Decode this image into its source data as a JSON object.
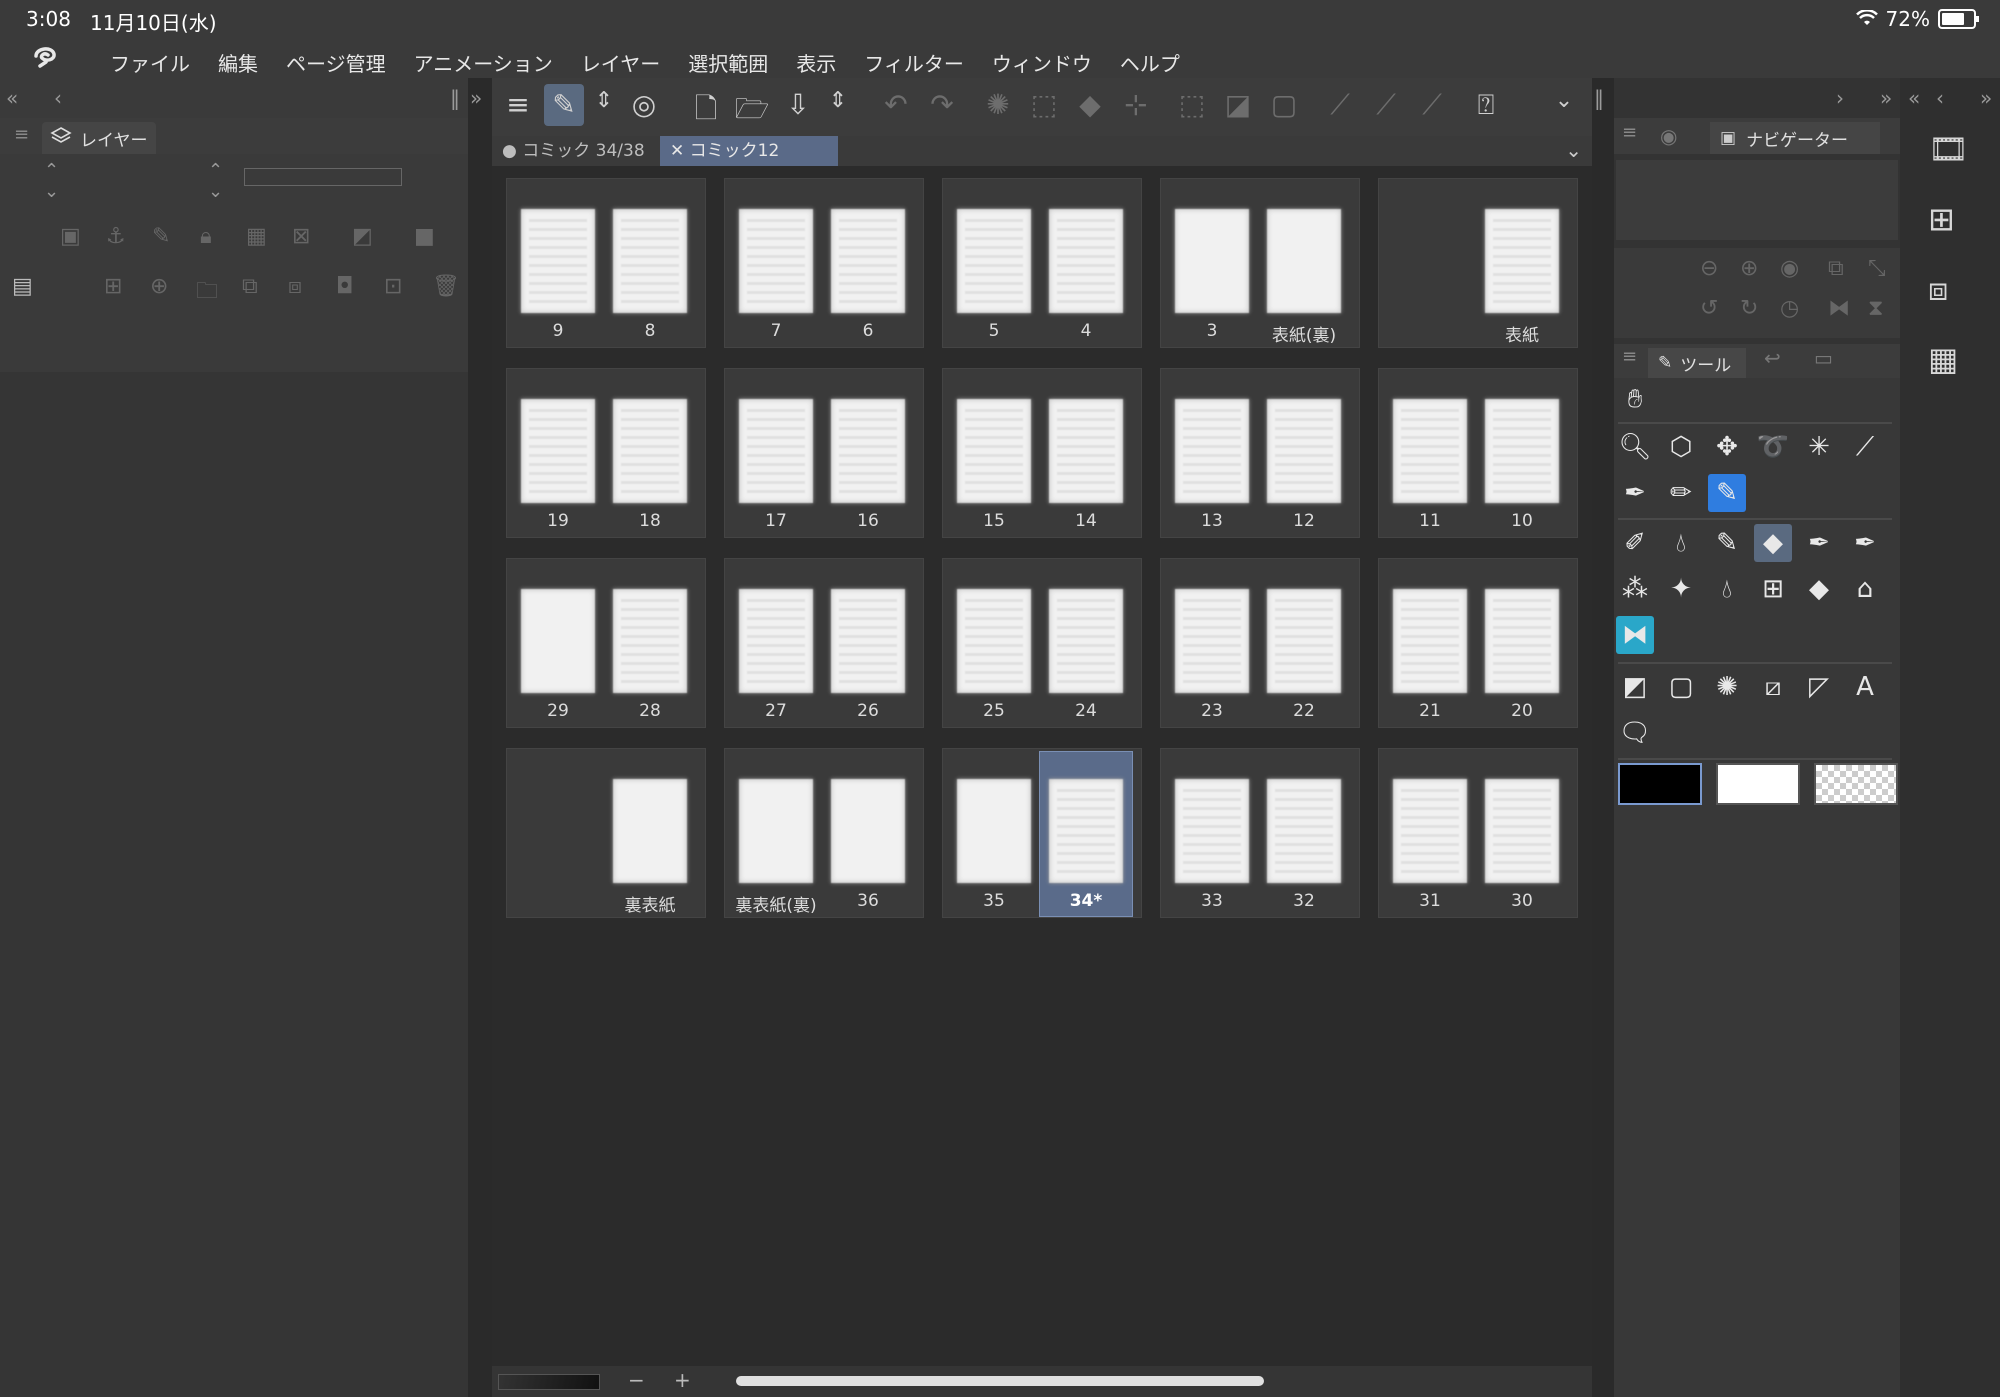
{
  "status": {
    "time": "3:08",
    "date": "11月10日(水)",
    "battery": "72%"
  },
  "menu": [
    "ファイル",
    "編集",
    "ページ管理",
    "アニメーション",
    "レイヤー",
    "選択範囲",
    "表示",
    "フィルター",
    "ウィンドウ",
    "ヘルプ"
  ],
  "layer_panel": {
    "title": "レイヤー"
  },
  "tabs": [
    {
      "label": "● コミック 34/38"
    },
    {
      "label": "✕ コミック12"
    }
  ],
  "spreads": [
    {
      "pages": [
        "9",
        "8"
      ]
    },
    {
      "pages": [
        "7",
        "6"
      ]
    },
    {
      "pages": [
        "5",
        "4"
      ]
    },
    {
      "pages": [
        "3",
        "表紙(裏)"
      ]
    },
    {
      "pages": [
        "",
        "表紙"
      ]
    },
    {
      "pages": [
        "19",
        "18"
      ]
    },
    {
      "pages": [
        "17",
        "16"
      ]
    },
    {
      "pages": [
        "15",
        "14"
      ]
    },
    {
      "pages": [
        "13",
        "12"
      ]
    },
    {
      "pages": [
        "11",
        "10"
      ]
    },
    {
      "pages": [
        "29",
        "28"
      ]
    },
    {
      "pages": [
        "27",
        "26"
      ]
    },
    {
      "pages": [
        "25",
        "24"
      ]
    },
    {
      "pages": [
        "23",
        "22"
      ]
    },
    {
      "pages": [
        "21",
        "20"
      ]
    },
    {
      "pages": [
        "",
        "裏表紙"
      ]
    },
    {
      "pages": [
        "裏表紙(裏)",
        "36"
      ]
    },
    {
      "pages": [
        "35",
        "34*"
      ]
    },
    {
      "pages": [
        "33",
        "32"
      ]
    },
    {
      "pages": [
        "31",
        "30"
      ]
    }
  ],
  "selected_page": "34*",
  "navigator": {
    "title": "ナビゲーター"
  },
  "tool_panel": {
    "title": "ツール"
  },
  "colors": {
    "main": "#000000",
    "sub": "#ffffff",
    "accent": "#2f7de0"
  }
}
